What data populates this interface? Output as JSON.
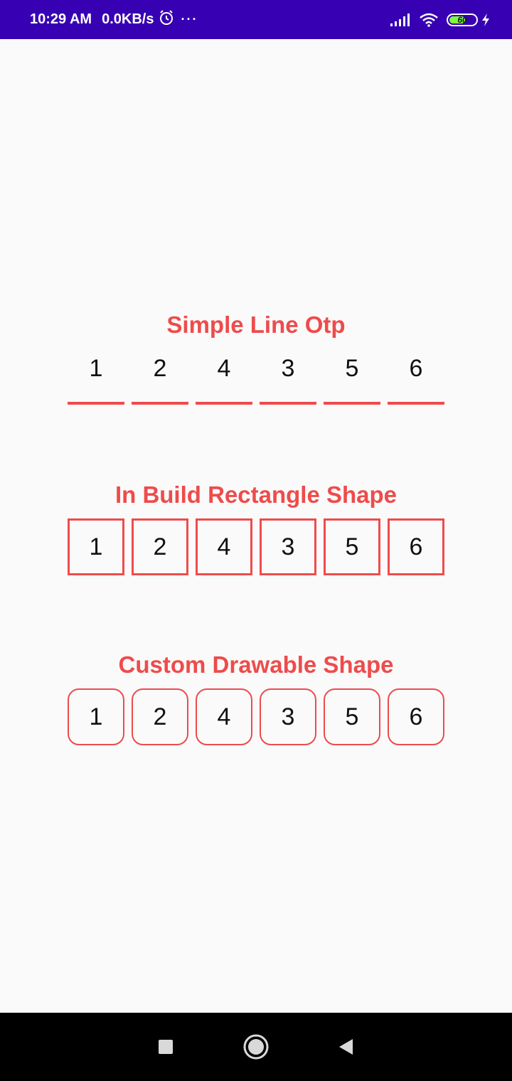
{
  "status_bar": {
    "time": "10:29 AM",
    "network_speed": "0.0KB/s",
    "more": "···",
    "battery_level": "60",
    "battery_fraction": 0.6
  },
  "sections": {
    "simple_line": {
      "title": "Simple Line Otp",
      "digits": [
        "1",
        "2",
        "4",
        "3",
        "5",
        "6"
      ]
    },
    "rectangle": {
      "title": "In Build Rectangle Shape",
      "digits": [
        "1",
        "2",
        "4",
        "3",
        "5",
        "6"
      ]
    },
    "custom": {
      "title": "Custom Drawable Shape",
      "digits": [
        "1",
        "2",
        "4",
        "3",
        "5",
        "6"
      ]
    }
  },
  "colors": {
    "accent": "#ef4b4b",
    "status_bar": "#3700b3",
    "background": "#fafafa"
  },
  "icons": {
    "alarm": "alarm-icon",
    "signal": "signal-icon",
    "wifi": "wifi-icon",
    "battery": "battery-icon",
    "charging": "charging-icon",
    "recent": "recent-apps-icon",
    "home": "home-icon",
    "back": "back-icon"
  }
}
